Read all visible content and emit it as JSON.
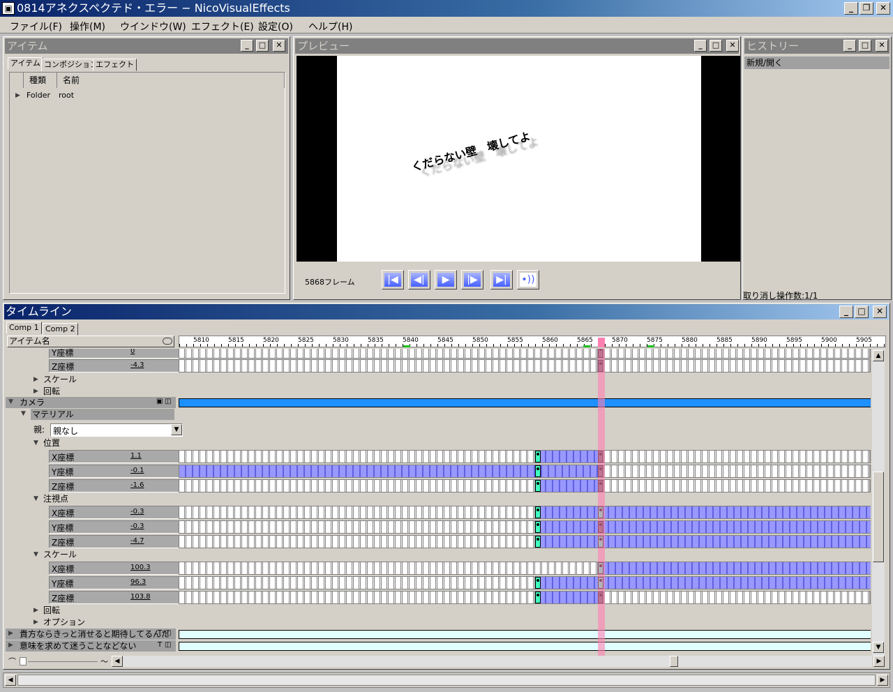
{
  "window": {
    "title": "0814アネクスペクテド・エラー − NicoVisualEffects",
    "icon": "app-icon"
  },
  "menu": [
    "ファイル(F)",
    "操作(M)",
    "ウインドウ(W)",
    "エフェクト(E)",
    "設定(O)",
    "ヘルプ(H)"
  ],
  "items_panel": {
    "title": "アイテム",
    "tabs": [
      "アイテム",
      "コンポジション",
      "エフェクト"
    ],
    "columns": [
      "種類",
      "名前"
    ],
    "rows": [
      {
        "type": "Folder",
        "name": "root"
      }
    ]
  },
  "preview": {
    "title": "プレビュー",
    "caption": "くだらない壁　壊してよ",
    "frame_label": "5868フレーム",
    "buttons": [
      "first-frame",
      "previous-frame",
      "play",
      "next-frame",
      "last-frame",
      "audio"
    ]
  },
  "history": {
    "title": "ヒストリー",
    "items": [
      "新規/開く"
    ],
    "status": "取り消し操作数:1/1"
  },
  "timeline": {
    "title": "タイムライン",
    "tabs": [
      "Comp 1",
      "Comp 2"
    ],
    "header_label": "アイテム名",
    "ruler": [
      "5810",
      "5815",
      "5820",
      "5825",
      "5830",
      "5835",
      "5840",
      "5845",
      "5850",
      "5855",
      "5860",
      "5865",
      "5870",
      "5875",
      "5880",
      "5885",
      "5890",
      "5895",
      "5900",
      "5905"
    ],
    "current_frame": 5868,
    "partial_top": [
      {
        "name": "Y座標",
        "value": "0"
      },
      {
        "name": "Z座標",
        "value": "-4.3"
      }
    ],
    "upper_groups": [
      "スケール",
      "回転"
    ],
    "camera_label": "カメラ",
    "material_label": "マテリアル",
    "parent_label": "親:",
    "parent_value": "親なし",
    "position_label": "位置",
    "position": [
      {
        "name": "X座標",
        "value": "1.1"
      },
      {
        "name": "Y座標",
        "value": "-0.1"
      },
      {
        "name": "Z座標",
        "value": "-1.6"
      }
    ],
    "target_label": "注視点",
    "target": [
      {
        "name": "X座標",
        "value": "-0.3"
      },
      {
        "name": "Y座標",
        "value": "-0.3"
      },
      {
        "name": "Z座標",
        "value": "-4.7"
      }
    ],
    "scale_label": "スケール",
    "scale": [
      {
        "name": "X座標",
        "value": "100.3"
      },
      {
        "name": "Y座標",
        "value": "96.3"
      },
      {
        "name": "Z座標",
        "value": "103.8"
      }
    ],
    "lower_groups": [
      "回転",
      "オプション"
    ],
    "text_layers": [
      "貴方ならきっと消せると期待してるんだ",
      "意味を求めて迷うことなどない"
    ],
    "text_layer_badge": "T"
  },
  "colors": {
    "titlebar": "#0a246a",
    "camera_track": "#1e90ff",
    "keyframe_segment": "#9898ff",
    "keyframe_active": "#40ffc0",
    "playhead": "#ff80b0"
  }
}
